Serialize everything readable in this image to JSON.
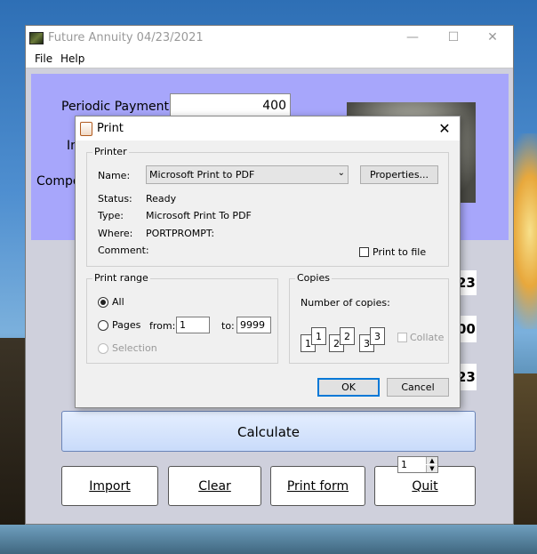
{
  "window": {
    "title": "Future Annuity 04/23/2021",
    "minimize": "—",
    "maximize": "☐",
    "close": "✕"
  },
  "menu": {
    "file": "File",
    "help": "Help"
  },
  "form": {
    "periodic_payment_label": "Periodic Payment:",
    "periodic_payment_value": "400",
    "interest_label_partial": "In",
    "compound_label_partial": "Compo"
  },
  "results": {
    "value1_partial": "23",
    "value2_partial": "00",
    "value3_partial": "23"
  },
  "buttons": {
    "calculate": "Calculate",
    "import": "Import",
    "clear": "Clear",
    "print_form": "Print form",
    "quit": "Quit"
  },
  "print_dialog": {
    "title": "Print",
    "close": "✕",
    "printer_group": "Printer",
    "name_label": "Name:",
    "name_value": "Microsoft Print to PDF",
    "properties_button": "Properties...",
    "status_label": "Status:",
    "status_value": "Ready",
    "type_label": "Type:",
    "type_value": "Microsoft Print To PDF",
    "where_label": "Where:",
    "where_value": "PORTPROMPT:",
    "comment_label": "Comment:",
    "print_to_file_label": "Print to file",
    "print_range_group": "Print range",
    "all_label": "All",
    "pages_label": "Pages",
    "from_label": "from:",
    "from_value": "1",
    "to_label": "to:",
    "to_value": "9999",
    "selection_label": "Selection",
    "copies_group": "Copies",
    "number_of_copies_label": "Number of copies:",
    "copies_value": "1",
    "collate_label": "Collate",
    "ok_button": "OK",
    "cancel_button": "Cancel",
    "collate_pages": [
      "1",
      "1",
      "2",
      "2",
      "3",
      "3"
    ]
  }
}
